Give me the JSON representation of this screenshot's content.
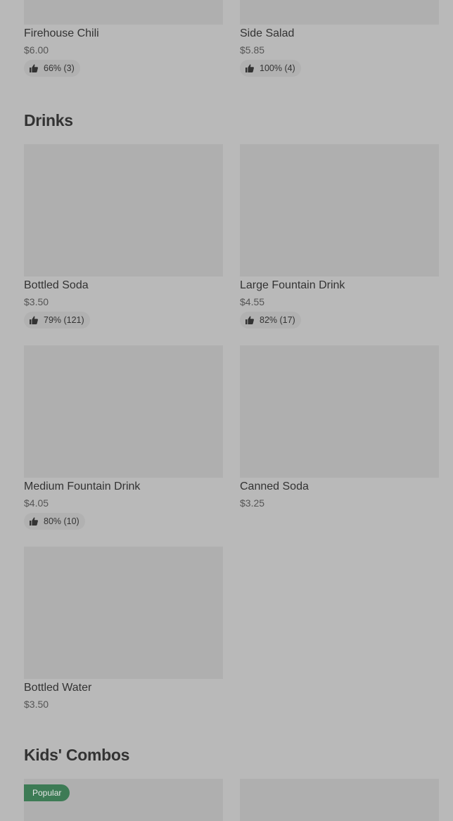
{
  "sections": {
    "drinks": {
      "title": "Drinks"
    },
    "kids": {
      "title": "Kids' Combos"
    }
  },
  "items": {
    "firehouse_chili": {
      "name": "Firehouse Chili",
      "price": "$6.00",
      "rating": "66% (3)"
    },
    "side_salad": {
      "name": "Side Salad",
      "price": "$5.85",
      "rating": "100% (4)"
    },
    "bottled_soda": {
      "name": "Bottled Soda",
      "price": "$3.50",
      "rating": "79% (121)"
    },
    "large_fountain": {
      "name": "Large Fountain Drink",
      "price": "$4.55",
      "rating": "82% (17)"
    },
    "medium_fountain": {
      "name": "Medium Fountain Drink",
      "price": "$4.05",
      "rating": "80% (10)"
    },
    "canned_soda": {
      "name": "Canned Soda",
      "price": "$3.25"
    },
    "bottled_water": {
      "name": "Bottled Water",
      "price": "$3.50"
    }
  },
  "badges": {
    "popular": "Popular"
  },
  "colors": {
    "background": "#b9b9b9",
    "image_placeholder": "#afafaf",
    "badge": "#3d7b55"
  },
  "icons": {
    "rating": "thumbs-up-icon"
  }
}
